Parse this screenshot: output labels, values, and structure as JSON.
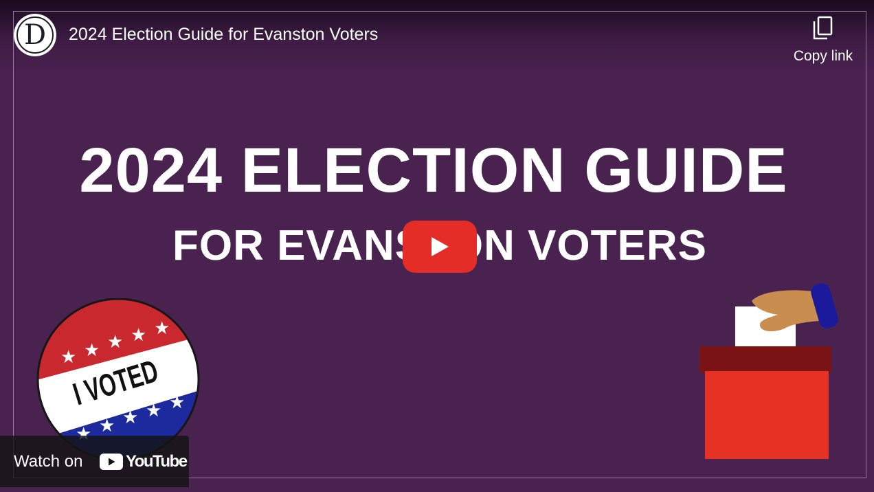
{
  "player": {
    "channel_logo_letter": "D",
    "title": "2024 Election Guide for Evanston Voters",
    "copy_link_label": "Copy link"
  },
  "thumbnail": {
    "headline_line1": "2024 ELECTION GUIDE",
    "headline_line2": "FOR EVANSTON VOTERS",
    "badge_text": "I VOTED"
  },
  "watch_on": {
    "label": "Watch on",
    "brand": "YouTube"
  },
  "colors": {
    "background": "#4a2250",
    "play_button": "#e52d27",
    "badge_red": "#c9282e",
    "badge_blue": "#1d2a9e",
    "ballot_box": "#e53224",
    "ballot_box_lid": "#7a1414",
    "sleeve": "#1a1a9a",
    "hand": "#c98d4f"
  },
  "icons": [
    "copy-icon",
    "play-icon",
    "youtube-icon"
  ]
}
